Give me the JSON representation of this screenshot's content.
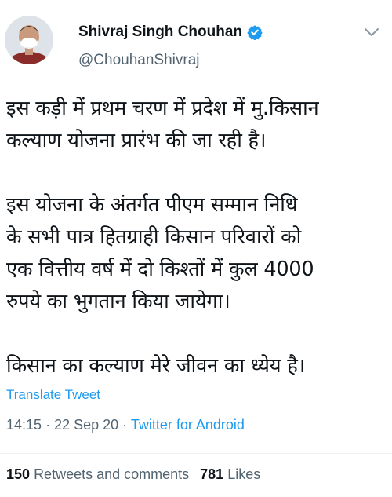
{
  "author": {
    "name": "Shivraj Singh Chouhan",
    "handle": "@ChouhanShivraj",
    "avatar_icon": "profile-photo",
    "verified_icon": "verified-badge-icon"
  },
  "tweet": {
    "text": "इस कड़ी में प्रथम चरण में प्रदेश में मु.किसान\nकल्याण योजना प्रारंभ की जा रही है।\n\nइस योजना के अंतर्गत पीएम सम्मान निधि\nके सभी पात्र हितग्राही किसान परिवारों को\nएक वित्तीय वर्ष में दो किश्तों में कुल 4000\nरुपये का भुगतान किया जायेगा।\n\nकिसान का कल्याण मेरे जीवन का ध्येय है।",
    "translate_label": "Translate Tweet"
  },
  "meta": {
    "time": "14:15",
    "separator": "·",
    "date": "22 Sep 20",
    "source": "Twitter for Android"
  },
  "stats": {
    "retweets_count": "150",
    "retweets_label": "Retweets and comments",
    "likes_count": "781",
    "likes_label": "Likes"
  },
  "colors": {
    "link": "#1d9bf0",
    "secondary_text": "#536471",
    "primary_text": "#0f1419"
  }
}
